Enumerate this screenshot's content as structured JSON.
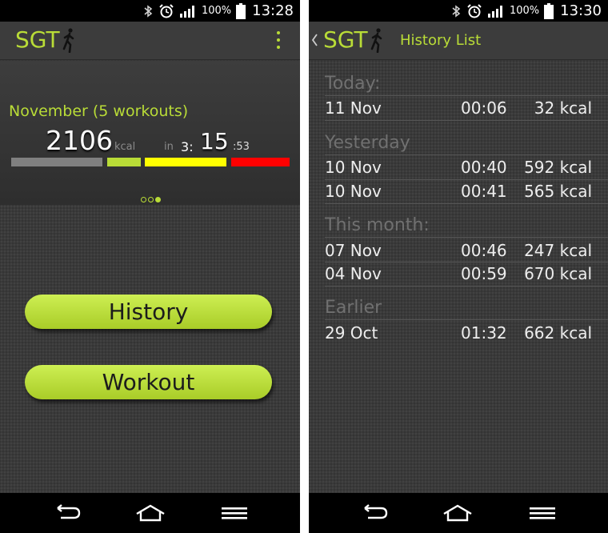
{
  "status_left": {
    "battery_pct": "100%",
    "time": "13:28"
  },
  "status_right": {
    "battery_pct": "100%",
    "time": "13:30"
  },
  "app": {
    "logo": "SGT",
    "accent": "#b9dc37"
  },
  "summary": {
    "month_label": "November (5 workouts)",
    "kcal_value": "2106",
    "kcal_unit": "kcal",
    "in_label": "in",
    "dur_hours": "3",
    "dur_minutes": "15",
    "dur_seconds": "53",
    "bar_colors": [
      "#808080",
      "#b9dc37",
      "#ffff00",
      "#ff0000"
    ],
    "pager": {
      "pages": 3,
      "active": 2
    }
  },
  "buttons": {
    "history": "History",
    "workout": "Workout"
  },
  "history": {
    "title": "History List",
    "sections": [
      {
        "label": "Today:",
        "rows": [
          {
            "date": "11 Nov",
            "duration": "00:06",
            "kcal": "32 kcal"
          }
        ]
      },
      {
        "label": "Yesterday",
        "rows": [
          {
            "date": "10 Nov",
            "duration": "00:40",
            "kcal": "592 kcal"
          },
          {
            "date": "10 Nov",
            "duration": "00:41",
            "kcal": "565 kcal"
          }
        ]
      },
      {
        "label": "This month:",
        "rows": [
          {
            "date": "07 Nov",
            "duration": "00:46",
            "kcal": "247 kcal"
          },
          {
            "date": "04 Nov",
            "duration": "00:59",
            "kcal": "670 kcal"
          }
        ]
      },
      {
        "label": "Earlier",
        "rows": [
          {
            "date": "29 Oct",
            "duration": "01:32",
            "kcal": "662 kcal"
          }
        ]
      }
    ]
  },
  "icons": [
    "bluetooth-icon",
    "alarm-icon",
    "signal-icon",
    "battery-icon",
    "runner-icon",
    "overflow-menu-icon",
    "back-chevron-icon",
    "back-nav-icon",
    "home-nav-icon",
    "menu-nav-icon"
  ]
}
